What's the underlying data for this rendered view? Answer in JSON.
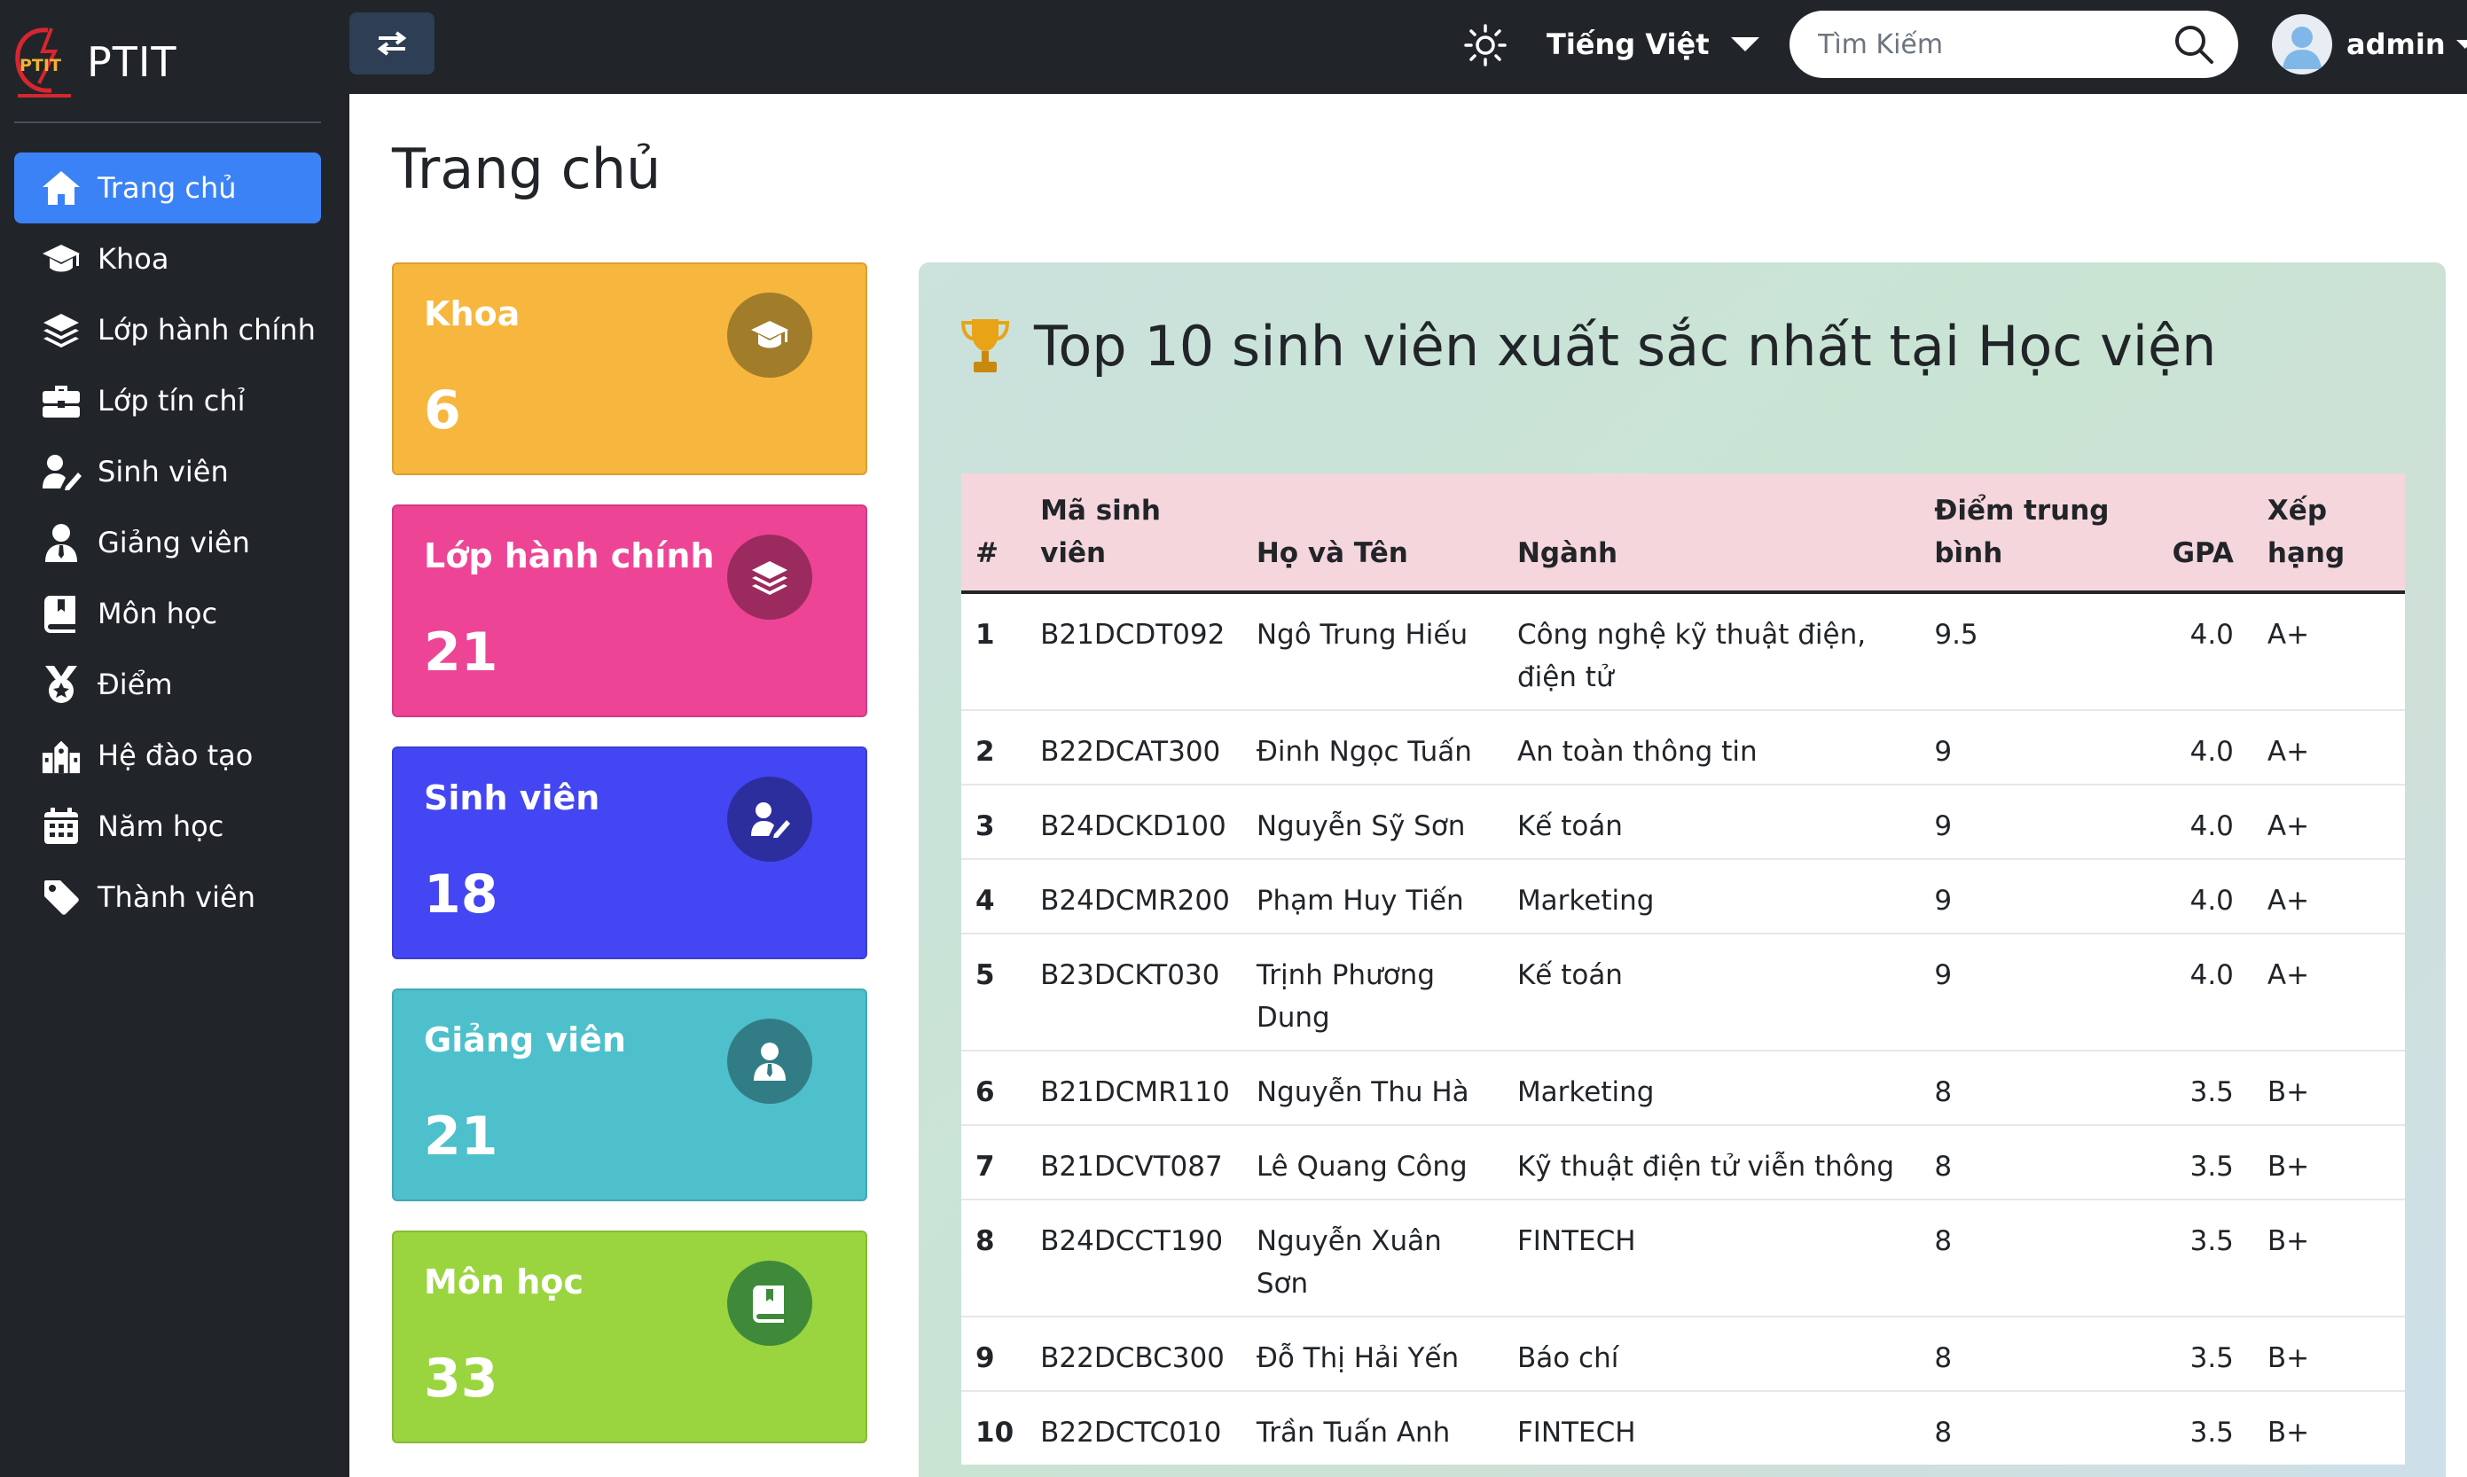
{
  "brand": {
    "name": "PTIT",
    "logo_text": "PTIT"
  },
  "sidebar": {
    "items": [
      {
        "label": "Trang chủ",
        "icon": "home-icon",
        "active": true
      },
      {
        "label": "Khoa",
        "icon": "graduation-cap-icon"
      },
      {
        "label": "Lớp hành chính",
        "icon": "layers-icon"
      },
      {
        "label": "Lớp tín chỉ",
        "icon": "briefcase-icon"
      },
      {
        "label": "Sinh viên",
        "icon": "user-edit-icon"
      },
      {
        "label": "Giảng viên",
        "icon": "user-tie-icon"
      },
      {
        "label": "Môn học",
        "icon": "book-icon"
      },
      {
        "label": "Điểm",
        "icon": "medal-icon"
      },
      {
        "label": "Hệ đào tạo",
        "icon": "school-icon"
      },
      {
        "label": "Năm học",
        "icon": "calendar-icon"
      },
      {
        "label": "Thành viên",
        "icon": "tag-icon"
      }
    ]
  },
  "topbar": {
    "language": "Tiếng Việt",
    "search_placeholder": "Tìm Kiếm",
    "user": "admin"
  },
  "page": {
    "title": "Trang chủ"
  },
  "cards": [
    {
      "label": "Khoa",
      "value": "6",
      "icon": "graduation-cap-icon",
      "color": "#f7b63d"
    },
    {
      "label": "Lớp hành chính",
      "value": "21",
      "icon": "layers-icon",
      "color": "#ee4496"
    },
    {
      "label": "Sinh viên",
      "value": "18",
      "icon": "user-edit-icon",
      "color": "#4346f2"
    },
    {
      "label": "Giảng viên",
      "value": "21",
      "icon": "user-tie-icon",
      "color": "#4dc0cc"
    },
    {
      "label": "Môn học",
      "value": "33",
      "icon": "book-icon",
      "color": "#9ad53f"
    }
  ],
  "top10": {
    "title": "Top 10 sinh viên xuất sắc nhất tại Học viện",
    "columns": [
      "#",
      "Mã sinh viên",
      "Họ và Tên",
      "Ngành",
      "Điểm trung bình",
      "GPA",
      "Xếp hạng"
    ],
    "rows": [
      [
        "1",
        "B21DCDT092",
        "Ngô Trung Hiếu",
        "Công nghệ kỹ thuật điện, điện tử",
        "9.5",
        "4.0",
        "A+"
      ],
      [
        "2",
        "B22DCAT300",
        "Đinh Ngọc Tuấn",
        "An toàn thông tin",
        "9",
        "4.0",
        "A+"
      ],
      [
        "3",
        "B24DCKD100",
        "Nguyễn Sỹ Sơn",
        "Kế toán",
        "9",
        "4.0",
        "A+"
      ],
      [
        "4",
        "B24DCMR200",
        "Phạm Huy Tiến",
        "Marketing",
        "9",
        "4.0",
        "A+"
      ],
      [
        "5",
        "B23DCKT030",
        "Trịnh Phương Dung",
        "Kế toán",
        "9",
        "4.0",
        "A+"
      ],
      [
        "6",
        "B21DCMR110",
        "Nguyễn Thu Hà",
        "Marketing",
        "8",
        "3.5",
        "B+"
      ],
      [
        "7",
        "B21DCVT087",
        "Lê Quang Công",
        "Kỹ thuật điện tử viễn thông",
        "8",
        "3.5",
        "B+"
      ],
      [
        "8",
        "B24DCCT190",
        "Nguyễn Xuân Sơn",
        "FINTECH",
        "8",
        "3.5",
        "B+"
      ],
      [
        "9",
        "B22DCBC300",
        "Đỗ Thị Hải Yến",
        "Báo chí",
        "8",
        "3.5",
        "B+"
      ],
      [
        "10",
        "B22DCTC010",
        "Trần Tuấn Anh",
        "FINTECH",
        "8",
        "3.5",
        "B+"
      ]
    ]
  }
}
